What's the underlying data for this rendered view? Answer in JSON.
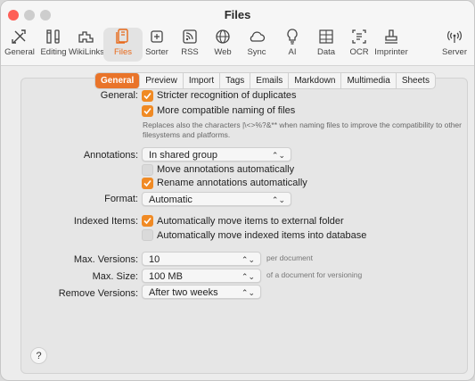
{
  "window": {
    "title": "Files"
  },
  "toolbar": {
    "items": [
      {
        "label": "General",
        "icon": "tools-icon"
      },
      {
        "label": "Editing",
        "icon": "editing-icon"
      },
      {
        "label": "WikiLinks",
        "icon": "wikilinks-icon"
      },
      {
        "label": "Files",
        "icon": "files-icon",
        "selected": true
      },
      {
        "label": "Sorter",
        "icon": "sorter-icon"
      },
      {
        "label": "RSS",
        "icon": "rss-icon"
      },
      {
        "label": "Web",
        "icon": "globe-icon"
      },
      {
        "label": "Sync",
        "icon": "cloud-icon"
      },
      {
        "label": "AI",
        "icon": "lightbulb-icon"
      },
      {
        "label": "Data",
        "icon": "data-icon"
      },
      {
        "label": "OCR",
        "icon": "ocr-icon"
      },
      {
        "label": "Imprinter",
        "icon": "imprinter-icon"
      },
      {
        "label": "Server",
        "icon": "server-icon"
      }
    ]
  },
  "tabs": [
    "General",
    "Preview",
    "Import",
    "Tags",
    "Emails",
    "Markdown",
    "Multimedia",
    "Sheets"
  ],
  "selected_tab": "General",
  "general": {
    "label": "General:",
    "stricter": {
      "label": "Stricter recognition of duplicates",
      "checked": true
    },
    "compatible": {
      "label": "More compatible naming of files",
      "checked": true
    },
    "note": "Replaces also the characters |\\<>%?&** when naming files to improve the compatibility to other filesystems and platforms."
  },
  "annotations": {
    "label": "Annotations:",
    "value": "In shared group",
    "move": {
      "label": "Move annotations automatically",
      "checked": false
    },
    "rename": {
      "label": "Rename annotations automatically",
      "checked": true
    }
  },
  "format": {
    "label": "Format:",
    "value": "Automatic"
  },
  "indexed": {
    "label": "Indexed Items:",
    "external": {
      "label": "Automatically move items to external folder",
      "checked": true
    },
    "database": {
      "label": "Automatically move indexed items into database",
      "checked": false
    }
  },
  "versions": {
    "max_versions": {
      "label": "Max. Versions:",
      "value": "10",
      "suffix": "per document"
    },
    "max_size": {
      "label": "Max. Size:",
      "value": "100 MB",
      "suffix": "of a document for versioning"
    },
    "remove": {
      "label": "Remove Versions:",
      "value": "After two weeks"
    }
  },
  "help": "?",
  "colors": {
    "accent": "#f08a24",
    "tab_selected": "#e9742a",
    "close": "#fe5f57",
    "minimize": "#c8c8c8",
    "zoom": "#c8c8c8"
  }
}
